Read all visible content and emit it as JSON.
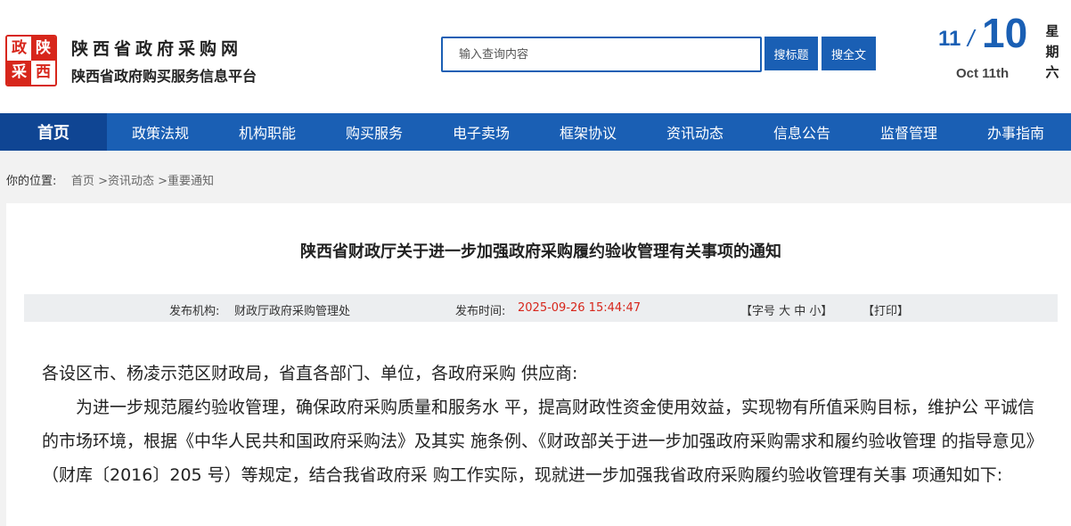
{
  "header": {
    "logo": [
      "政",
      "陕",
      "采",
      "西"
    ],
    "site_name": "陕西省政府采购网",
    "site_subtitle": "陕西省政府购买服务信息平台"
  },
  "search": {
    "placeholder": "输入查询内容",
    "btn_title": "搜标题",
    "btn_all": "搜全文"
  },
  "date": {
    "month": "11",
    "slash": "/",
    "day": "10",
    "en": "Oct 11th",
    "weekday": [
      "星",
      "期",
      "六"
    ]
  },
  "nav": {
    "items": [
      "首页",
      "政策法规",
      "机构职能",
      "购买服务",
      "电子卖场",
      "框架协议",
      "资讯动态",
      "信息公告",
      "监督管理",
      "办事指南"
    ]
  },
  "breadcrumb": {
    "label": "你的位置:",
    "home": "首页",
    "sep1": " >",
    "news": "资讯动态",
    "sep2": " >",
    "current": "重要通知"
  },
  "article": {
    "title": "陕西省财政厅关于进一步加强政府采购履约验收管理有关事项的通知",
    "publisher_label": "发布机构:",
    "publisher": "财政厅政府采购管理处",
    "time_label": "发布时间:",
    "time": "2025-09-26 15:44:47",
    "font_size_ctrl": "【字号 大 中 小】",
    "print": "【打印】",
    "salutation": "各设区市、杨凌示范区财政局，省直各部门、单位，各政府采购 供应商:",
    "paragraph": "为进一步规范履约验收管理，确保政府采购质量和服务水 平，提高财政性资金使用效益，实现物有所值采购目标，维护公 平诚信的市场环境，根据《中华人民共和国政府采购法》及其实 施条例、《财政部关于进一步加强政府采购需求和履约验收管理 的指导意见》（财库〔2016〕205 号）等规定，结合我省政府采 购工作实际，现就进一步加强我省政府采购履约验收管理有关事 项通知如下:"
  },
  "colors": {
    "brand_blue": "#1a5fb4",
    "nav_active": "#0f4593",
    "logo_red": "#d7261b",
    "time_red": "#d7261b"
  }
}
